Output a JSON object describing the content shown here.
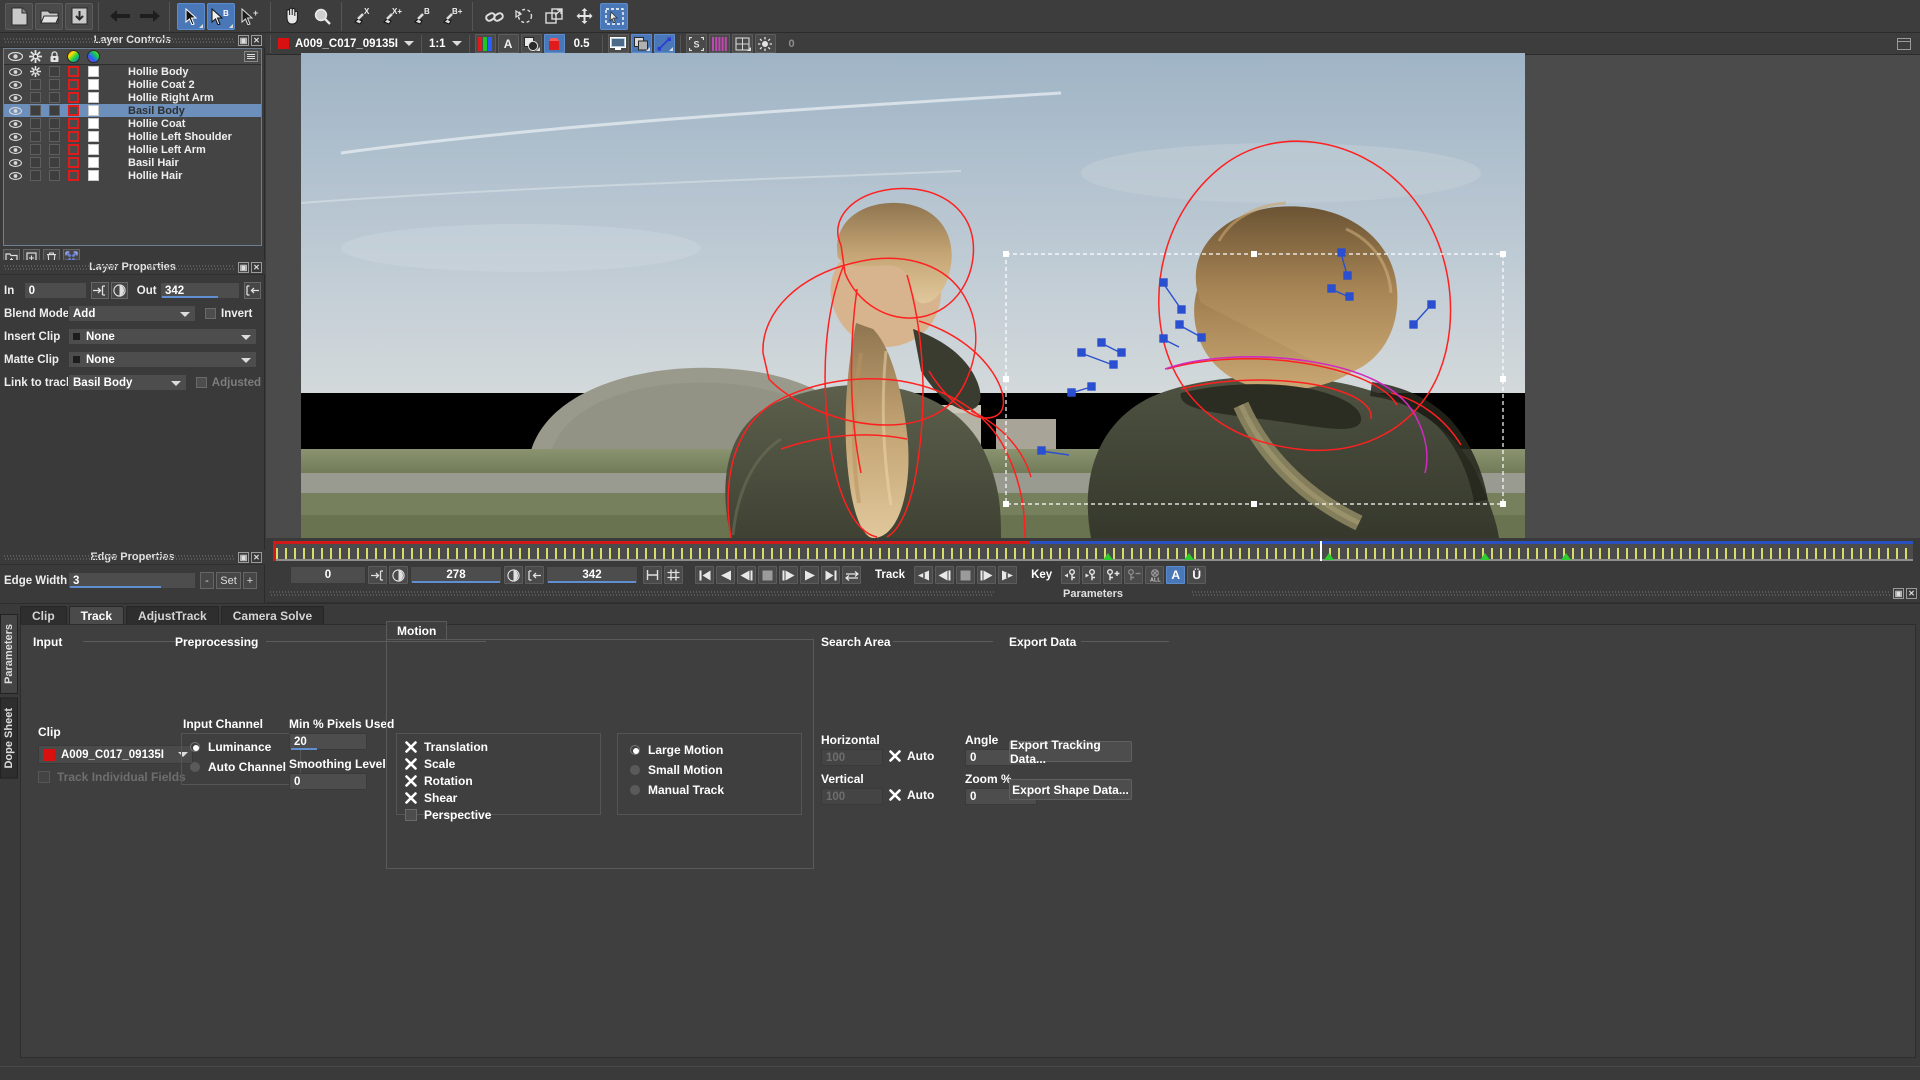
{
  "toolbar": {
    "groups": [
      {
        "name": "file",
        "buttons": [
          {
            "name": "new-project-button",
            "icon": "document-icon"
          },
          {
            "name": "open-project-button",
            "icon": "folder-icon"
          },
          {
            "name": "save-project-button",
            "icon": "save-icon"
          }
        ]
      },
      {
        "name": "history",
        "buttons": [
          {
            "name": "undo-button",
            "icon": "arrow-left-icon"
          },
          {
            "name": "redo-button",
            "icon": "arrow-right-icon"
          }
        ]
      },
      {
        "name": "selection-tools",
        "buttons": [
          {
            "name": "select-tool",
            "icon": "cursor-icon",
            "selected": true
          },
          {
            "name": "select-b-tool",
            "icon": "cursor-b-icon",
            "selected": true
          },
          {
            "name": "add-point-tool",
            "icon": "cursor-plus-icon"
          }
        ]
      },
      {
        "name": "navigation-tools",
        "buttons": [
          {
            "name": "pan-tool",
            "icon": "hand-icon"
          },
          {
            "name": "zoom-tool",
            "icon": "magnifier-icon"
          }
        ]
      },
      {
        "name": "pen-tools",
        "buttons": [
          {
            "name": "xspline-tool",
            "icon": "pen-x-icon"
          },
          {
            "name": "xspline-add-tool",
            "icon": "pen-x-plus-icon"
          },
          {
            "name": "bezier-tool",
            "icon": "pen-b-icon"
          },
          {
            "name": "bezier-add-tool",
            "icon": "pen-b-plus-icon"
          }
        ]
      },
      {
        "name": "transform-tools",
        "buttons": [
          {
            "name": "link-tool",
            "icon": "chain-link-icon"
          },
          {
            "name": "rotate-tool",
            "icon": "rotate-icon"
          },
          {
            "name": "scale-tool",
            "icon": "scale-icon"
          },
          {
            "name": "move-tool",
            "icon": "move-cross-icon"
          },
          {
            "name": "marquee-select-tool",
            "icon": "marquee-icon",
            "selected": true
          }
        ]
      }
    ]
  },
  "viewer_bar": {
    "clip_name": "A009_C017_09135I",
    "zoom_level": "1:1",
    "opacity_value": "0.5",
    "buttons": [
      {
        "name": "channel-rgb-button",
        "icon": "rgb-bars-icon"
      },
      {
        "name": "alpha-channel-button",
        "icon": "letter-a-icon"
      },
      {
        "name": "matte-overlay-button",
        "icon": "overlap-shapes-icon"
      },
      {
        "name": "mask-color-button",
        "icon": "red-mask-icon"
      },
      {
        "name": "monitor-view-button",
        "icon": "monitor-icon"
      },
      {
        "name": "layers-view-button",
        "icon": "stacked-layers-icon"
      },
      {
        "name": "spline-view-button",
        "icon": "spline-points-icon"
      },
      {
        "name": "surface-button",
        "icon": "letter-s-icon"
      },
      {
        "name": "grid-button",
        "icon": "grid-icon"
      },
      {
        "name": "light-button",
        "icon": "sun-icon"
      },
      {
        "name": "gamma-value",
        "icon": "gamma-field"
      }
    ],
    "gamma_value": "0"
  },
  "layer_controls": {
    "title": "Layer Controls",
    "columns": [
      "visible-eye",
      "gear",
      "lock",
      "outline-color",
      "fill-color"
    ],
    "layers": [
      {
        "label": "Hollie Body",
        "visible": true,
        "gear": true,
        "selected": false
      },
      {
        "label": "Hollie Coat 2",
        "visible": true,
        "gear": false,
        "selected": false
      },
      {
        "label": "Hollie Right Arm",
        "visible": true,
        "gear": false,
        "selected": false
      },
      {
        "label": "Basil Body",
        "visible": true,
        "gear": false,
        "selected": true
      },
      {
        "label": "Hollie Coat",
        "visible": true,
        "gear": false,
        "selected": false
      },
      {
        "label": "Hollie Left Shoulder",
        "visible": true,
        "gear": false,
        "selected": false
      },
      {
        "label": "Hollie Left Arm",
        "visible": true,
        "gear": false,
        "selected": false
      },
      {
        "label": "Basil Hair",
        "visible": true,
        "gear": false,
        "selected": false
      },
      {
        "label": "Hollie Hair",
        "visible": true,
        "gear": false,
        "selected": false
      }
    ],
    "tools": [
      {
        "name": "new-layer-group-button",
        "icon": "folder-plus-icon"
      },
      {
        "name": "new-layer-button",
        "icon": "page-plus-icon"
      },
      {
        "name": "delete-layer-button",
        "icon": "trash-icon"
      },
      {
        "name": "expand-layer-button",
        "icon": "expand-arrows-icon"
      }
    ]
  },
  "layer_properties": {
    "title": "Layer Properties",
    "in_label": "In",
    "in_value": "0",
    "out_label": "Out",
    "out_value": "342",
    "blend_mode_label": "Blend Mode",
    "blend_mode_value": "Add",
    "invert_label": "Invert",
    "invert_checked": false,
    "insert_clip_label": "Insert Clip",
    "insert_clip_value": "None",
    "matte_clip_label": "Matte Clip",
    "matte_clip_value": "None",
    "link_to_track_label": "Link to track",
    "link_to_track_value": "Basil Body",
    "adjusted_label": "Adjusted",
    "adjusted_checked": false
  },
  "edge_properties": {
    "title": "Edge Properties",
    "edge_width_label": "Edge Width",
    "edge_width_value": "3",
    "minus_label": "-",
    "set_label": "Set",
    "plus_label": "+"
  },
  "transport": {
    "current_frame": "0",
    "mark_in_value": "278",
    "mark_out_value": "342",
    "track_label": "Track",
    "key_label": "Key",
    "playback_buttons": [
      {
        "name": "go-to-start-button",
        "icon": "skip-start-icon"
      },
      {
        "name": "play-backward-button",
        "icon": "play-back-icon"
      },
      {
        "name": "step-back-button",
        "icon": "step-back-icon"
      },
      {
        "name": "stop-button",
        "icon": "stop-icon"
      },
      {
        "name": "step-forward-button",
        "icon": "step-forward-icon"
      },
      {
        "name": "play-forward-button",
        "icon": "play-forward-icon"
      },
      {
        "name": "go-to-end-button",
        "icon": "skip-end-icon"
      },
      {
        "name": "loop-button",
        "icon": "loop-icon"
      }
    ],
    "track_buttons": [
      {
        "name": "track-backward-button",
        "icon": "track-back-icon"
      },
      {
        "name": "track-step-back-button",
        "icon": "track-step-back-icon"
      },
      {
        "name": "track-stop-button",
        "icon": "track-stop-icon"
      },
      {
        "name": "track-step-forward-button",
        "icon": "track-step-fwd-icon"
      },
      {
        "name": "track-forward-button",
        "icon": "track-fwd-icon"
      }
    ],
    "key_buttons": [
      {
        "name": "previous-key-button",
        "icon": "key-prev-icon"
      },
      {
        "name": "next-key-button",
        "icon": "key-next-icon"
      },
      {
        "name": "add-key-button",
        "icon": "key-add-icon"
      },
      {
        "name": "remove-key-button",
        "icon": "key-remove-icon"
      },
      {
        "name": "delete-all-keys-button",
        "icon": "key-all-icon"
      },
      {
        "name": "auto-key-button",
        "icon": "letter-a-icon",
        "active": true
      },
      {
        "name": "overwrite-key-button",
        "icon": "letter-o-icon"
      }
    ]
  },
  "parameters": {
    "title": "Parameters",
    "vertical_tabs": [
      {
        "label": "Parameters",
        "active": true
      },
      {
        "label": "Dope Sheet",
        "active": false
      }
    ],
    "tabs": [
      {
        "label": "Clip",
        "active": false
      },
      {
        "label": "Track",
        "active": true
      },
      {
        "label": "AdjustTrack",
        "active": false
      },
      {
        "label": "Camera Solve",
        "active": false
      }
    ],
    "input": {
      "section_title": "Input",
      "clip_label": "Clip",
      "clip_value": "A009_C017_09135I",
      "track_individual_fields_label": "Track Individual Fields",
      "track_individual_fields_checked": false
    },
    "preprocessing": {
      "section_title": "Preprocessing",
      "input_channel_label": "Input Channel",
      "channels": [
        {
          "label": "Luminance",
          "selected": true
        },
        {
          "label": "Auto Channel",
          "selected": false
        }
      ],
      "min_pixels_label": "Min % Pixels Used",
      "min_pixels_value": "20",
      "smoothing_label": "Smoothing Level",
      "smoothing_value": "0"
    },
    "motion": {
      "tab_label": "Motion",
      "checkboxes": [
        {
          "label": "Translation",
          "checked": true
        },
        {
          "label": "Scale",
          "checked": true
        },
        {
          "label": "Rotation",
          "checked": true
        },
        {
          "label": "Shear",
          "checked": true
        },
        {
          "label": "Perspective",
          "checked": false
        }
      ],
      "modes": [
        {
          "label": "Large Motion",
          "selected": true
        },
        {
          "label": "Small Motion",
          "selected": false
        },
        {
          "label": "Manual Track",
          "selected": false
        }
      ]
    },
    "search_area": {
      "section_title": "Search Area",
      "horizontal_label": "Horizontal",
      "horizontal_value": "100",
      "horizontal_auto_label": "Auto",
      "horizontal_auto_checked": true,
      "vertical_label": "Vertical",
      "vertical_value": "100",
      "vertical_auto_label": "Auto",
      "vertical_auto_checked": true,
      "angle_label": "Angle",
      "angle_value": "0",
      "zoom_label": "Zoom %",
      "zoom_value": "0"
    },
    "export_data": {
      "section_title": "Export Data",
      "export_tracking_label": "Export Tracking Data...",
      "export_shape_label": "Export Shape Data..."
    }
  },
  "colors": {
    "accent_blue": "#4a77b8",
    "selection_blue": "#6d8fbb",
    "spline_red": "#e01b1b",
    "spline_magenta": "#c030b0",
    "track_point_blue": "#2a4fd0",
    "panel_bg": "#3a3a3a",
    "timeline_green": "#2ecc2e",
    "timeline_yellow": "#d8dc6a"
  }
}
